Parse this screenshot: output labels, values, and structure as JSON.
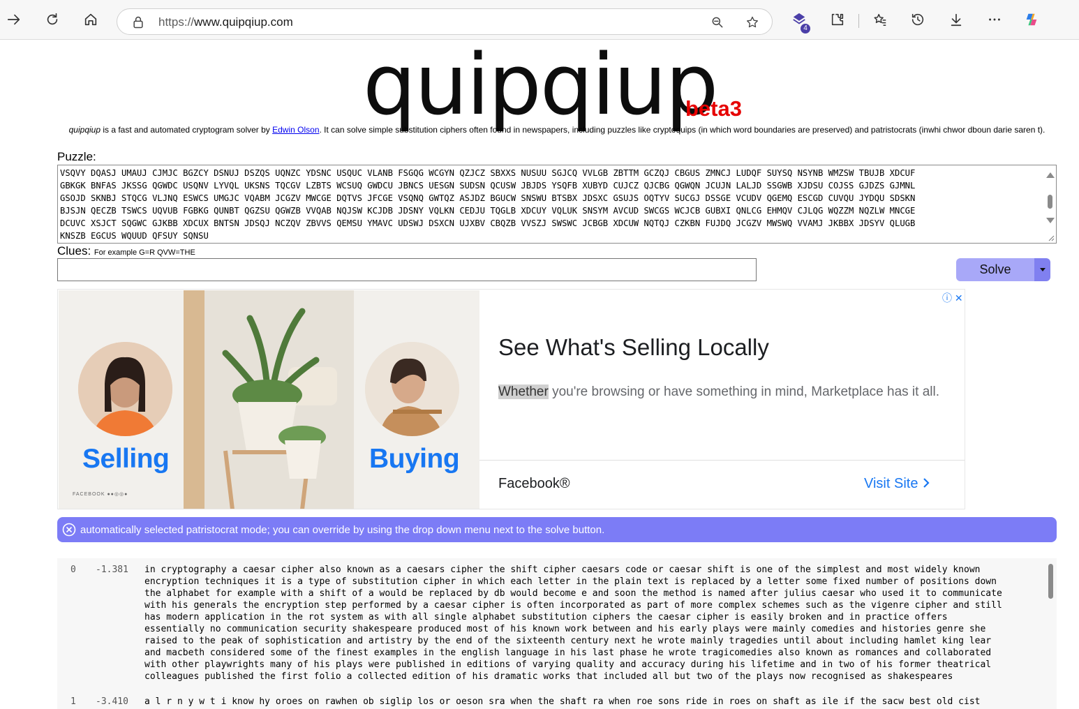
{
  "browser": {
    "url_protocol": "https://",
    "url_host": "www.quipqiup.com",
    "extension_badge": "4"
  },
  "page": {
    "logo": "quipqiup",
    "beta": "beta3",
    "tagline_pre_italic": "quipqiup",
    "tagline_pre": " is a fast and automated cryptogram solver by ",
    "tagline_link": "Edwin Olson",
    "tagline_post": ". It can solve simple substitution ciphers often found in newspapers, including puzzles like cryptoquips (in which word boundaries are preserved) and patristocrats (inwhi chwor dboun darie saren t).",
    "puzzle_label": "Puzzle:",
    "puzzle_text": "VSQVY DQASJ UMAUJ CJMJC BGZCY DSNUJ DSZQS UQNZC YDSNC USQUC VLANB FSGQG WCGYN QZJCZ SBXXS NUSUU SGJCQ VVLGB ZBTTM GCZQJ CBGUS ZMNCJ LUDQF SUYSQ NSYNB WMZSW TBUJB XDCUF\nGBKGK BNFAS JKSSG QGWDC USQNV LYVQL UKSNS TQCGV LZBTS WCSUQ GWDCU JBNCS UESGN SUDSN QCUSW JBJDS YSQFB XUBYD CUJCZ QJCBG QGWQN JCUJN LALJD SSGWB XJDSU COJSS GJDZS GJMNL\nGSOJD SKNBJ STQCG VLJNQ ESWCS UMGJC VQABM JCGZV MWCGE DQTVS JFCGE VSQNQ GWTQZ ASJDZ BGUCW SNSWU BTSBX JDSXC GSUJS OQTYV SUCGJ DSSGE VCUDV QGEMQ ESCGD CUVQU JYDQU SDSKN\nBJSJN QECZB TSWCS UQVUB FGBKG QUNBT QGZSU QGWZB VVQAB NQJSW KCJDB JDSNY VQLKN CEDJU TQGLB XDCUY VQLUK SNSYM AVCUD SWCGS WCJCB GUBXI QNLCG EHMQV CJLQG WQZZM NQZLW MNCGE\nDCUVC XSJCT SQGWC GJKBB XDCUX BNTSN JDSQJ NCZQV ZBVVS QEMSU YMAVC UDSWJ DSXCN UJXBV CBQZB VVSZJ SWSWC JCBGB XDCUW NQTQJ CZKBN FUJDQ JCGZV MWSWQ VVAMJ JKBBX JDSYV QLUGB\nKNSZB EGCUS WQUUD QFSUY SQNSU",
    "clues_label": "Clues:",
    "clues_hint": "For example G=R QVW=THE",
    "clues_value": "",
    "solve_label": "Solve"
  },
  "ad": {
    "left_label": "Selling",
    "right_label": "Buying",
    "mini_brand": "FACEBOOK ●●◎◎●",
    "title": "See What's Selling Locally",
    "body_highlight": "Whether",
    "body_rest": " you're browsing or have something in mind, Marketplace has it all.",
    "brand": "Facebook®",
    "cta": "Visit Site",
    "info_glyphs": "ⓘ ✕"
  },
  "notice": {
    "text": "automatically selected patristocrat mode; you can override by using the drop down menu next to the solve button."
  },
  "results": [
    {
      "index": "0",
      "score": "-1.381",
      "text": "in cryptography a caesar cipher also known as a caesars cipher the shift cipher caesars code or caesar shift is one of the simplest and most widely known\nencryption techniques it is a type of substitution cipher in which each letter in the plain text is replaced by a letter some fixed number of positions down\nthe alphabet for example with a shift of a would be replaced by db would become e and soon the method is named after julius caesar who used it to communicate\nwith his generals the encryption step performed by a caesar cipher is often incorporated as part of more complex schemes such as the vigenre cipher and still\nhas modern application in the rot system as with all single alphabet substitution ciphers the caesar cipher is easily broken and in practice offers\nessentially no communication security shakespeare produced most of his known work between and his early plays were mainly comedies and histories genre she\nraised to the peak of sophistication and artistry by the end of the sixteenth century next he wrote mainly tragedies until about including hamlet king lear\nand macbeth considered some of the finest examples in the english language in his last phase he wrote tragicomedies also known as romances and collaborated\nwith other playwrights many of his plays were published in editions of varying quality and accuracy during his lifetime and in two of his former theatrical\ncolleagues published the first folio a collected edition of his dramatic works that included all but two of the plays now recognised as shakespeares"
    },
    {
      "index": "1",
      "score": "-3.410",
      "text": "a l r n y w t i know hy oroes on rawhen ob siglip los or oeson sra when the shaft ra when roe sons ride in roes on shaft as ile if the sacw best old cist"
    }
  ]
}
